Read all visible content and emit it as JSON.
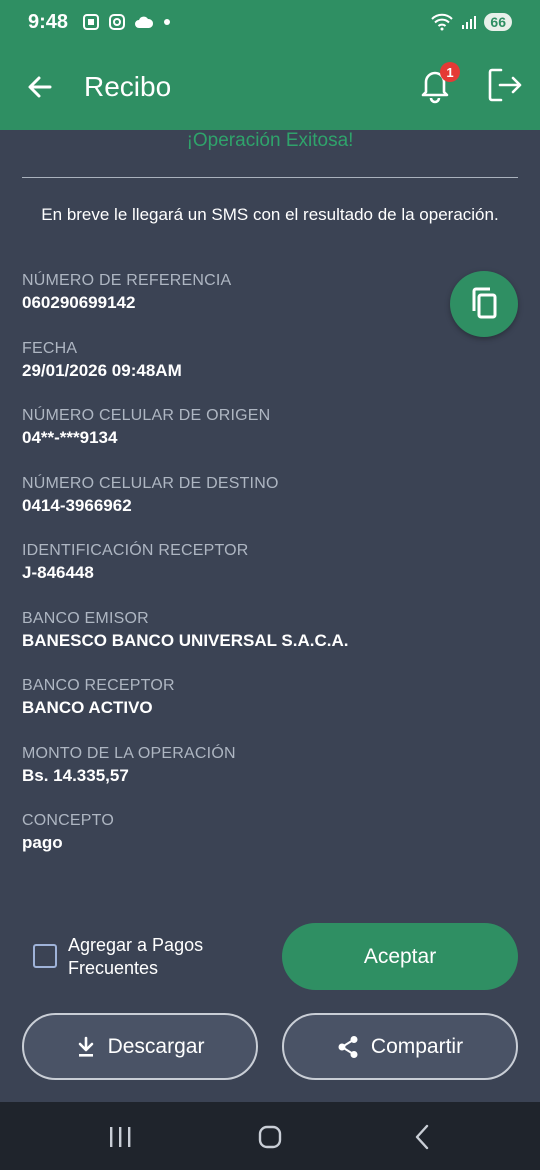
{
  "status_bar": {
    "time": "9:48",
    "battery": "66"
  },
  "app_bar": {
    "title": "Recibo",
    "notification_count": "1"
  },
  "receipt": {
    "success_title": "¡Operación Exitosa!",
    "sms_message": "En breve le llegará un SMS con el resultado de la operación.",
    "fields": [
      {
        "label": "NÚMERO DE REFERENCIA",
        "value": "060290699142"
      },
      {
        "label": "FECHA",
        "value": "29/01/2026 09:48AM"
      },
      {
        "label": "NÚMERO CELULAR DE ORIGEN",
        "value": "04**-***9134"
      },
      {
        "label": "NÚMERO CELULAR DE DESTINO",
        "value": "0414-3966962"
      },
      {
        "label": "IDENTIFICACIÓN RECEPTOR",
        "value": "J-846448"
      },
      {
        "label": "BANCO EMISOR",
        "value": "BANESCO BANCO UNIVERSAL S.A.C.A."
      },
      {
        "label": "BANCO RECEPTOR",
        "value": "BANCO ACTIVO"
      },
      {
        "label": "MONTO DE LA OPERACIÓN",
        "value": "Bs. 14.335,57"
      },
      {
        "label": "CONCEPTO",
        "value": "pago"
      }
    ]
  },
  "actions": {
    "favorites_label": "Agregar a Pagos Frecuentes",
    "favorites_checked": false,
    "accept_label": "Aceptar",
    "download_label": "Descargar",
    "share_label": "Compartir"
  },
  "colors": {
    "primary": "#2f8f63",
    "background": "#3b4354",
    "success_text": "#2fa36b",
    "badge": "#e53935"
  },
  "icons": {
    "back": "arrow-left-icon",
    "notifications": "bell-icon",
    "logout": "logout-icon",
    "copy": "copy-icon",
    "download": "download-icon",
    "share": "share-icon"
  }
}
